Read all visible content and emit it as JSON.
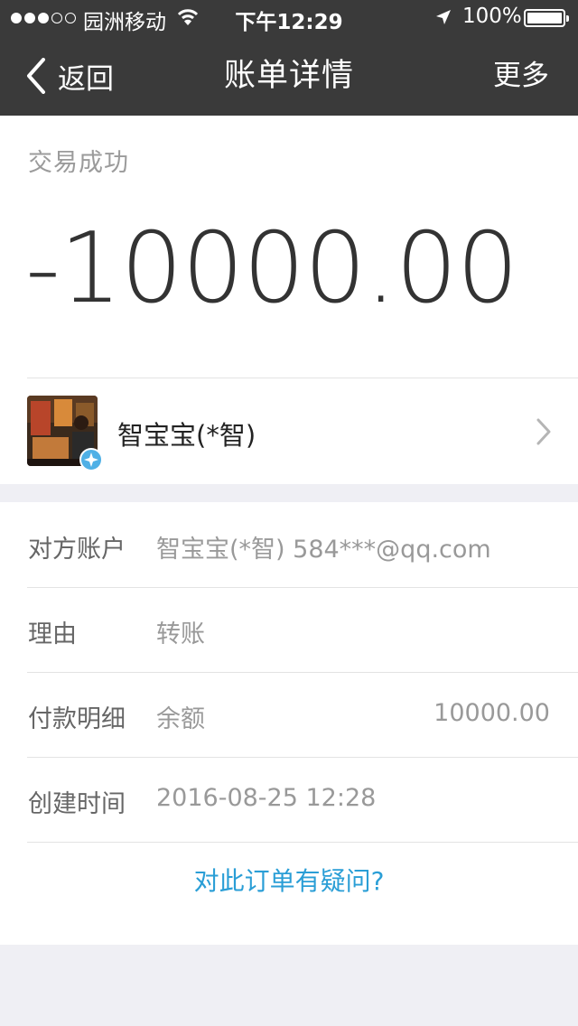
{
  "status_bar": {
    "carrier": "园洲移动",
    "time": "下午12:29",
    "battery": "100%",
    "signal_bars": 3,
    "signal_total": 5
  },
  "nav": {
    "back_label": "返回",
    "title": "账单详情",
    "more_label": "更多"
  },
  "summary": {
    "status": "交易成功",
    "amount": "-10000.00",
    "party_name": "智宝宝(*智)"
  },
  "details": {
    "counterparty": {
      "label": "对方账户",
      "value": "智宝宝(*智) 584***@qq.com"
    },
    "reason": {
      "label": "理由",
      "value": "转账"
    },
    "payment": {
      "label": "付款明细",
      "method": "余额",
      "amount": "10000.00"
    },
    "created": {
      "label": "创建时间",
      "value": "2016-08-25 12:28"
    }
  },
  "question_link": "对此订单有疑问?",
  "colors": {
    "nav_bg": "#3a3a3a",
    "link": "#2a9ed6",
    "badge": "#4fb0e6"
  }
}
